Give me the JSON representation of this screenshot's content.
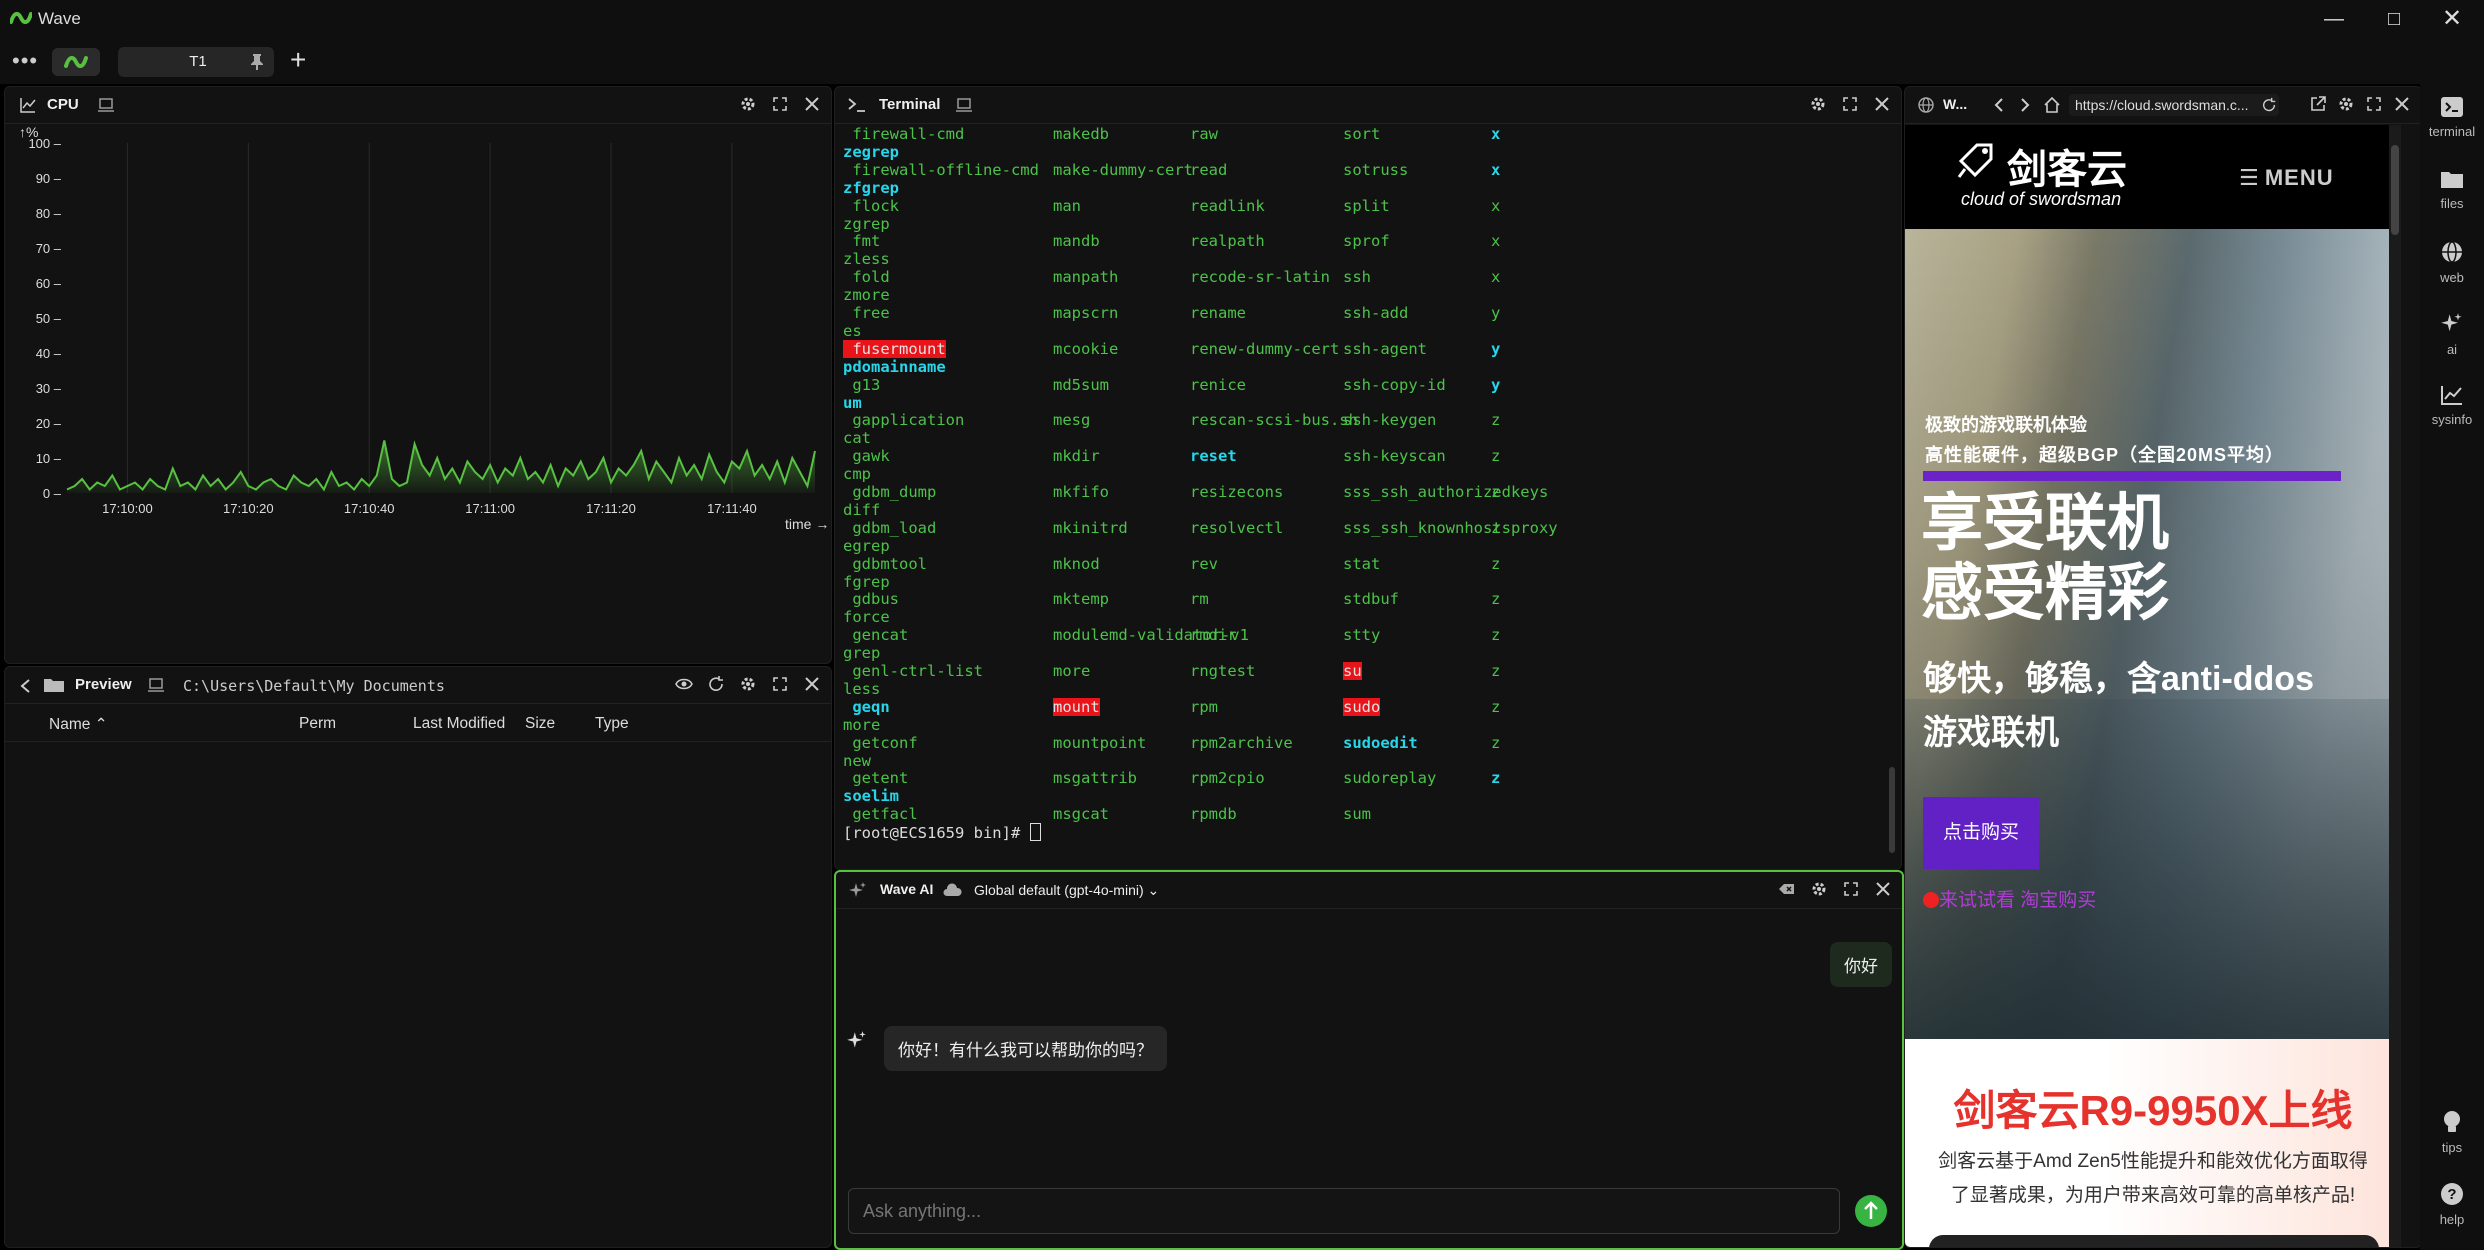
{
  "app": {
    "title": "Wave"
  },
  "tabbar": {
    "dots": "•••",
    "tab_label": "T1",
    "add": "+"
  },
  "cpu": {
    "title": "CPU",
    "chart_data": {
      "type": "area",
      "title": "",
      "ylabel": "%",
      "xlabel": "time",
      "ylim": [
        0,
        100
      ],
      "y_ticks": [
        0,
        10,
        20,
        30,
        40,
        50,
        60,
        70,
        80,
        90,
        100
      ],
      "x_ticks": [
        "17:10:00",
        "17:10:20",
        "17:10:40",
        "17:11:00",
        "17:11:20",
        "17:11:40"
      ],
      "color": "#58c142",
      "values": [
        1,
        2,
        4,
        1,
        3,
        2,
        5,
        1,
        2,
        3,
        1,
        4,
        2,
        1,
        7,
        2,
        3,
        1,
        5,
        2,
        4,
        1,
        3,
        6,
        2,
        1,
        3,
        4,
        2,
        1,
        5,
        3,
        2,
        4,
        1,
        6,
        2,
        3,
        1,
        4,
        2,
        5,
        15,
        4,
        2,
        3,
        14,
        8,
        5,
        10,
        4,
        7,
        3,
        9,
        6,
        4,
        8,
        3,
        7,
        5,
        10,
        4,
        6,
        3,
        8,
        2,
        7,
        5,
        9,
        4,
        6,
        10,
        3,
        7,
        5,
        8,
        12,
        4,
        9,
        6,
        3,
        10,
        5,
        8,
        4,
        11,
        6,
        3,
        9,
        7,
        12,
        5,
        8,
        4,
        9,
        3,
        10,
        6,
        2,
        12
      ]
    }
  },
  "preview": {
    "title": "Preview",
    "path": "C:\\Users\\Default\\My Documents",
    "columns": [
      "Name",
      "Perm",
      "Last Modified",
      "Size",
      "Type"
    ]
  },
  "terminal": {
    "title": "Terminal",
    "left_lines": [
      {
        "t": " firewall-cmd",
        "c": "green"
      },
      {
        "t": "zegrep",
        "c": "cyan"
      },
      {
        "t": " firewall-offline-cmd",
        "c": "green"
      },
      {
        "t": "zfgrep",
        "c": "cyan"
      },
      {
        "t": " flock",
        "c": "green"
      },
      {
        "t": "zgrep",
        "c": "green"
      },
      {
        "t": " fmt",
        "c": "green"
      },
      {
        "t": "zless",
        "c": "green"
      },
      {
        "t": " fold",
        "c": "green"
      },
      {
        "t": "zmore",
        "c": "green"
      },
      {
        "t": " free",
        "c": "green"
      },
      {
        "t": "es",
        "c": "green"
      },
      {
        "t": " fusermount",
        "c": "red"
      },
      {
        "t": "pdomainname",
        "c": "cyan"
      },
      {
        "t": " g13",
        "c": "green"
      },
      {
        "t": "um",
        "c": "cyan"
      },
      {
        "t": " gapplication",
        "c": "green"
      },
      {
        "t": "cat",
        "c": "green"
      },
      {
        "t": " gawk",
        "c": "green"
      },
      {
        "t": "cmp",
        "c": "green"
      },
      {
        "t": " gdbm_dump",
        "c": "green"
      },
      {
        "t": "diff",
        "c": "green"
      },
      {
        "t": " gdbm_load",
        "c": "green"
      },
      {
        "t": "egrep",
        "c": "green"
      },
      {
        "t": " gdbmtool",
        "c": "green"
      },
      {
        "t": "fgrep",
        "c": "green"
      },
      {
        "t": " gdbus",
        "c": "green"
      },
      {
        "t": "force",
        "c": "green"
      },
      {
        "t": " gencat",
        "c": "green"
      },
      {
        "t": "grep",
        "c": "green"
      },
      {
        "t": " genl-ctrl-list",
        "c": "green"
      },
      {
        "t": "less",
        "c": "green"
      },
      {
        "t": " geqn",
        "c": "cyan"
      },
      {
        "t": "more",
        "c": "green"
      },
      {
        "t": " getconf",
        "c": "green"
      },
      {
        "t": "new",
        "c": "green"
      },
      {
        "t": " getent",
        "c": "green"
      },
      {
        "t": "soelim",
        "c": "cyan"
      },
      {
        "t": " getfacl",
        "c": "green"
      }
    ],
    "col2": [
      {
        "t": "makedb",
        "c": "green"
      },
      {
        "t": "make-dummy-cert",
        "c": "green"
      },
      {
        "t": "man",
        "c": "green"
      },
      {
        "t": "mandb",
        "c": "green"
      },
      {
        "t": "manpath",
        "c": "green"
      },
      {
        "t": "mapscrn",
        "c": "green"
      },
      {
        "t": "mcookie",
        "c": "green"
      },
      {
        "t": "md5sum",
        "c": "green"
      },
      {
        "t": "mesg",
        "c": "green"
      },
      {
        "t": "mkdir",
        "c": "green"
      },
      {
        "t": "mkfifo",
        "c": "green"
      },
      {
        "t": "mkinitrd",
        "c": "green"
      },
      {
        "t": "mknod",
        "c": "green"
      },
      {
        "t": "mktemp",
        "c": "green"
      },
      {
        "t": "modulemd-validator-v1",
        "c": "green"
      },
      {
        "t": "more",
        "c": "green"
      },
      {
        "t": "mount",
        "c": "red"
      },
      {
        "t": "mountpoint",
        "c": "green"
      },
      {
        "t": "msgattrib",
        "c": "green"
      },
      {
        "t": "msgcat",
        "c": "green"
      }
    ],
    "col3": [
      {
        "t": "raw",
        "c": "green"
      },
      {
        "t": "read",
        "c": "green"
      },
      {
        "t": "readlink",
        "c": "green"
      },
      {
        "t": "realpath",
        "c": "green"
      },
      {
        "t": "recode-sr-latin",
        "c": "green"
      },
      {
        "t": "rename",
        "c": "green"
      },
      {
        "t": "renew-dummy-cert",
        "c": "green"
      },
      {
        "t": "renice",
        "c": "green"
      },
      {
        "t": "rescan-scsi-bus.sh",
        "c": "green"
      },
      {
        "t": "reset",
        "c": "cyan"
      },
      {
        "t": "resizecons",
        "c": "green"
      },
      {
        "t": "resolvectl",
        "c": "green"
      },
      {
        "t": "rev",
        "c": "green"
      },
      {
        "t": "rm",
        "c": "green"
      },
      {
        "t": "rmdir",
        "c": "green"
      },
      {
        "t": "rngtest",
        "c": "green"
      },
      {
        "t": "rpm",
        "c": "green"
      },
      {
        "t": "rpm2archive",
        "c": "green"
      },
      {
        "t": "rpm2cpio",
        "c": "green"
      },
      {
        "t": "rpmdb",
        "c": "green"
      }
    ],
    "col4": [
      {
        "t": "sort",
        "c": "green"
      },
      {
        "t": "sotruss",
        "c": "green"
      },
      {
        "t": "split",
        "c": "green"
      },
      {
        "t": "sprof",
        "c": "green"
      },
      {
        "t": "ssh",
        "c": "green"
      },
      {
        "t": "ssh-add",
        "c": "green"
      },
      {
        "t": "ssh-agent",
        "c": "green"
      },
      {
        "t": "ssh-copy-id",
        "c": "green"
      },
      {
        "t": "ssh-keygen",
        "c": "green"
      },
      {
        "t": "ssh-keyscan",
        "c": "green"
      },
      {
        "t": "sss_ssh_authorizedkeys",
        "c": "green"
      },
      {
        "t": "sss_ssh_knownhostsproxy",
        "c": "green"
      },
      {
        "t": "stat",
        "c": "green"
      },
      {
        "t": "stdbuf",
        "c": "green"
      },
      {
        "t": "stty",
        "c": "green"
      },
      {
        "t": "su",
        "c": "red"
      },
      {
        "t": "sudo",
        "c": "red"
      },
      {
        "t": "sudoedit",
        "c": "cyan"
      },
      {
        "t": "sudoreplay",
        "c": "green"
      },
      {
        "t": "sum",
        "c": "green"
      }
    ],
    "col5": [
      {
        "t": "x",
        "c": "cyan"
      },
      {
        "t": "x",
        "c": "cyan"
      },
      {
        "t": "x",
        "c": "green"
      },
      {
        "t": "x",
        "c": "green"
      },
      {
        "t": "x",
        "c": "green"
      },
      {
        "t": "y",
        "c": "green"
      },
      {
        "t": "y",
        "c": "cyan"
      },
      {
        "t": "y",
        "c": "cyan"
      },
      {
        "t": "z",
        "c": "green"
      },
      {
        "t": "z",
        "c": "green"
      },
      {
        "t": "z",
        "c": "green"
      },
      {
        "t": "z",
        "c": "green"
      },
      {
        "t": "z",
        "c": "green"
      },
      {
        "t": "z",
        "c": "green"
      },
      {
        "t": "z",
        "c": "green"
      },
      {
        "t": "z",
        "c": "green"
      },
      {
        "t": "z",
        "c": "green"
      },
      {
        "t": "z",
        "c": "green"
      },
      {
        "t": "z",
        "c": "cyan"
      }
    ],
    "prompt": "[root@ECS1659 bin]# "
  },
  "ai": {
    "title": "Wave AI",
    "model": "Global default (gpt-4o-mini)",
    "user_msg": "你好",
    "assistant_msg": "你好！有什么我可以帮助你的吗？",
    "input_placeholder": "Ask anything..."
  },
  "web": {
    "title": "W...",
    "url": "https://cloud.swordsman.c...",
    "brand_cn": "剑客云",
    "brand_en": "cloud of swordsman",
    "menu": "MENU",
    "tag1": "极致的游戏联机体验",
    "tag2": "高性能硬件，超级BGP（全国20MS平均）",
    "headline1": "享受联机",
    "headline2": "感受精彩",
    "sub1": "够快，够稳，含anti-ddos",
    "sub2": "游戏联机",
    "buy": "点击购买",
    "links": "来试试看 淘宝购买",
    "promo_title": "剑客云R9-9950X上线",
    "promo_body": "剑客云基于Amd Zen5性能提升和能效优化方面取得了显著成果，为用户带来高效可靠的高单核产品!"
  },
  "rail": {
    "terminal": "terminal",
    "files": "files",
    "web": "web",
    "ai": "ai",
    "sysinfo": "sysinfo",
    "tips": "tips",
    "help": "help"
  }
}
